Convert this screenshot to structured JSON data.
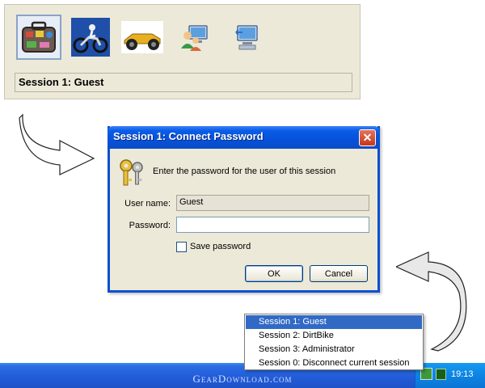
{
  "user_panel": {
    "session_label": "Session 1: Guest",
    "avatars": [
      {
        "name": "suitcase-avatar",
        "selected": true
      },
      {
        "name": "dirtbike-avatar",
        "selected": false
      },
      {
        "name": "racecar-avatar",
        "selected": false
      },
      {
        "name": "users-computer-icon",
        "selected": false
      },
      {
        "name": "computer-disconnect-icon",
        "selected": false
      }
    ]
  },
  "dialog": {
    "title": "Session 1: Connect Password",
    "prompt": "Enter the password for the user of this session",
    "username_label": "User name:",
    "username_value": "Guest",
    "password_label": "Password:",
    "password_value": "",
    "save_password_label": "Save password",
    "save_password_checked": false,
    "ok_label": "OK",
    "cancel_label": "Cancel",
    "close_glyph": "✕"
  },
  "taskbar": {
    "watermark": "GearDownload.com",
    "clock": "19:13"
  },
  "menu": {
    "items": [
      {
        "label": "Session 1: Guest",
        "highlighted": true
      },
      {
        "label": "Session 2: DirtBike",
        "highlighted": false
      },
      {
        "label": "Session 3: Administrator",
        "highlighted": false
      },
      {
        "label": "Session 0: Disconnect current session",
        "highlighted": false
      }
    ]
  },
  "colors": {
    "title_bar_blue": "#0a5ce8",
    "menu_highlight": "#316ac5",
    "panel_background": "#ece9d8"
  }
}
